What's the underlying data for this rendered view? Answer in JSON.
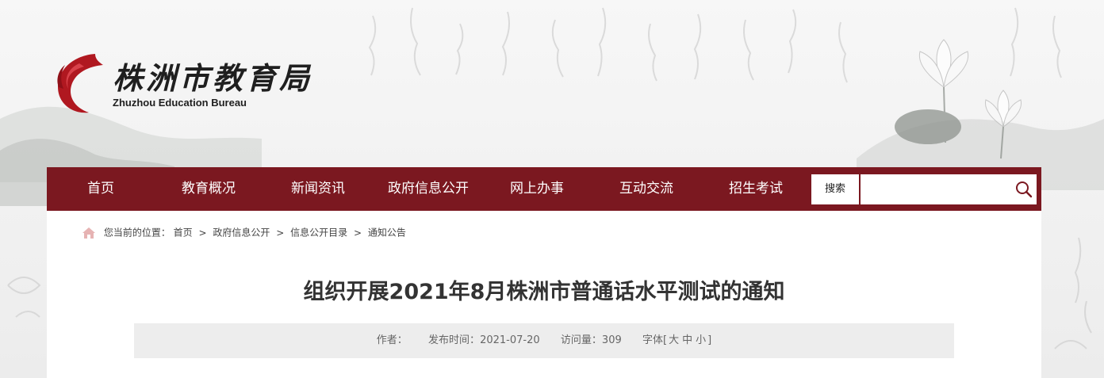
{
  "header": {
    "logo_title": "株洲市教育局",
    "logo_subtitle": "Zhuzhou Education Bureau"
  },
  "colors": {
    "nav_bg": "#7b1820",
    "logo_red": "#b01820"
  },
  "nav": {
    "items": [
      {
        "label": "首页"
      },
      {
        "label": "教育概况"
      },
      {
        "label": "新闻资讯"
      },
      {
        "label": "政府信息公开"
      },
      {
        "label": "网上办事"
      },
      {
        "label": "互动交流"
      },
      {
        "label": "招生考试"
      }
    ],
    "search_label": "搜索",
    "search_value": ""
  },
  "breadcrumb": {
    "prefix": "您当前的位置：",
    "items": [
      "首页",
      "政府信息公开",
      "信息公开目录",
      "通知公告"
    ],
    "separator": ">"
  },
  "article": {
    "title": "组织开展2021年8月株洲市普通话水平测试的通知",
    "author_label": "作者：",
    "author": "",
    "publish_label": "发布时间：",
    "publish_time": "2021-07-20",
    "views_label": "访问量：",
    "views": "309",
    "font_label": "字体[",
    "font_large": "大",
    "font_medium": "中",
    "font_small": "小",
    "font_close": "]"
  }
}
